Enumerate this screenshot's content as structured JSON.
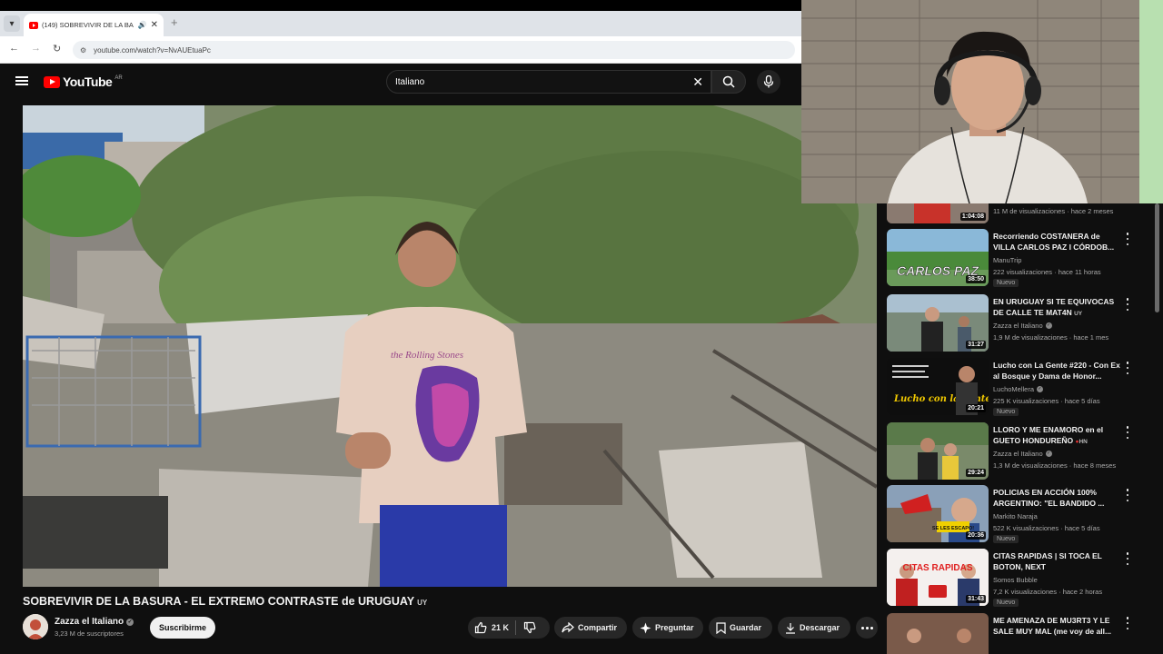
{
  "browser": {
    "tab_title": "(149) SOBREVIVIR DE LA BA",
    "url": "youtube.com/watch?v=NvAUEtuaPc"
  },
  "youtube": {
    "logo_text": "YouTube",
    "region": "AR",
    "search_query": "Italiano"
  },
  "video": {
    "title": "SOBREVIVIR DE LA BASURA - EL EXTREMO CONTRASTE de URUGUAY",
    "title_flag": "UY",
    "shirt_text": "the Rolling Stones"
  },
  "channel": {
    "name": "Zazza el Italiano",
    "subscribers": "3,23 M de suscriptores",
    "subscribe_label": "Suscribirme"
  },
  "actions": {
    "likes": "21 K",
    "share": "Compartir",
    "ask": "Preguntar",
    "save": "Guardar",
    "download": "Descargar"
  },
  "sidebar": {
    "top_partial": {
      "duration": "1:04:08",
      "meta": "11 M de visualizaciones · hace 2 meses"
    },
    "items": [
      {
        "title": "Recorriendo COSTANERA de VILLA CARLOS PAZ I CÓRDOB...",
        "channel": "ManuTrip",
        "verified": false,
        "meta": "222 visualizaciones · hace 11 horas",
        "badge": "Nuevo",
        "duration": "38:50",
        "thumb_text": "CARLOS PAZ",
        "thumb_color": "#4a8a3a"
      },
      {
        "title": "EN URUGUAY SI TE EQUIVOCAS DE CALLE TE MAT4N",
        "title_flag": "UY",
        "channel": "Zazza el Italiano",
        "verified": true,
        "meta": "1,9 M de visualizaciones · hace 1 mes",
        "badge": "",
        "duration": "31:27",
        "thumb_text": "",
        "thumb_color": "#6a7a8a"
      },
      {
        "title": "Lucho con La Gente #220 - Con Ex al Bosque y Dama de Honor...",
        "channel": "LuchoMellera",
        "verified": true,
        "meta": "225 K visualizaciones · hace 5 días",
        "badge": "Nuevo",
        "duration": "20:21",
        "thumb_text": "Lucho con la gente",
        "thumb_color": "#111111"
      },
      {
        "title": "LLORO Y ME ENAMORO en el GUETO HONDUREÑO",
        "title_flag": "HN",
        "channel": "Zazza el Italiano",
        "verified": true,
        "meta": "1,3 M de visualizaciones · hace 8 meses",
        "badge": "",
        "duration": "29:24",
        "thumb_text": "",
        "thumb_color": "#5a7a4a"
      },
      {
        "title": "POLICIAS EN ACCIÓN 100% ARGENTINO: \"EL BANDIDO ...",
        "channel": "Markito Naraja",
        "verified": false,
        "meta": "522 K visualizaciones · hace 5 días",
        "badge": "Nuevo",
        "duration": "20:36",
        "thumb_text": "SE LES ESCAPO!",
        "thumb_color": "#4a6a8a"
      },
      {
        "title": "CITAS RAPIDAS | SI TOCA EL BOTON, NEXT",
        "channel": "Somos Bubble",
        "verified": false,
        "meta": "7,2 K visualizaciones · hace 2 horas",
        "badge": "Nuevo",
        "duration": "31:43",
        "thumb_text": "CITAS RAPIDAS",
        "thumb_color": "#e8e8e8"
      },
      {
        "title": "ME AMENAZA DE MU3RT3 Y LE SALE MUY MAL (me voy de all...",
        "channel": "",
        "verified": false,
        "meta": "",
        "badge": "",
        "duration": "",
        "thumb_text": "",
        "thumb_color": "#7a5a4a"
      }
    ]
  },
  "colors": {
    "background": "#0f0f0f",
    "brand_red": "#ff0000",
    "chip": "#272727"
  }
}
